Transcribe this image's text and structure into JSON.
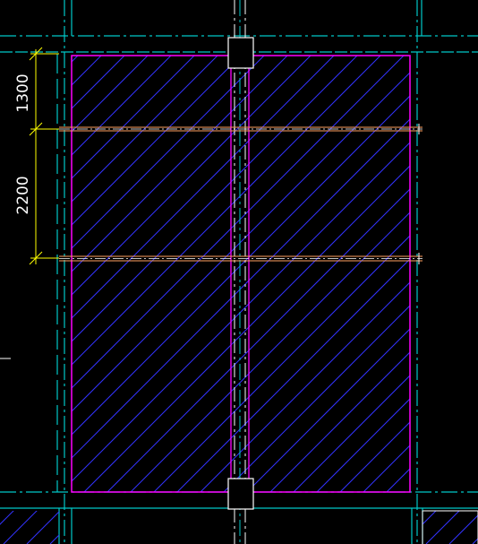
{
  "dimensions": {
    "upper": "1300",
    "lower": "2200"
  },
  "colors": {
    "background": "#000000",
    "grid_lines": "#00c8c8",
    "slab_outline": "#ff00ff",
    "hatch": "#3333ff",
    "dimension_line": "#ffff00",
    "beam_line": "#ffa060",
    "white_lines": "#ffffff"
  }
}
